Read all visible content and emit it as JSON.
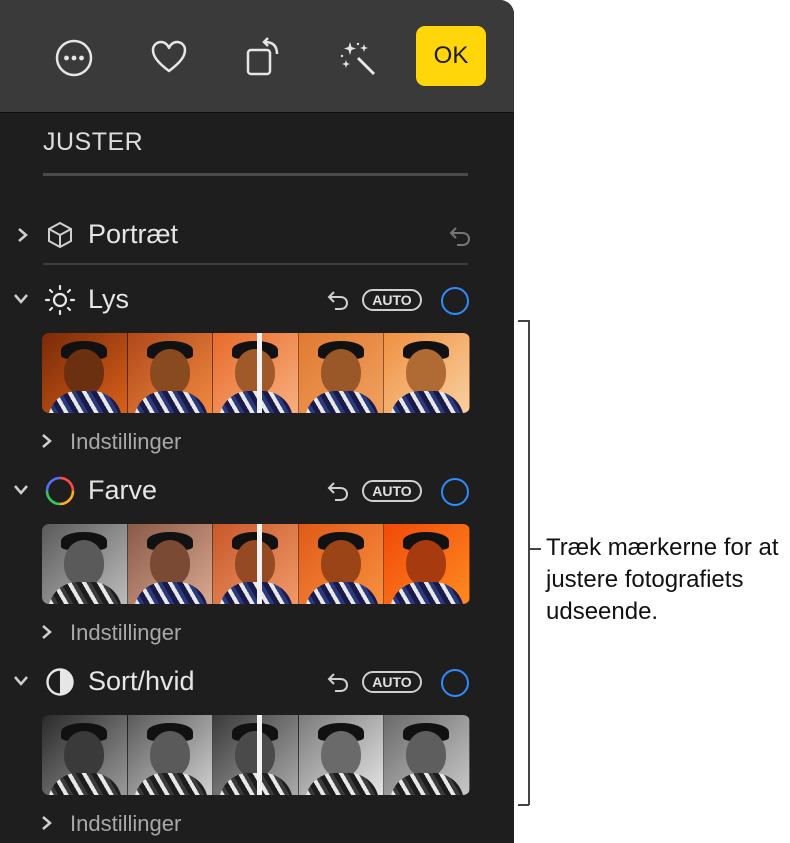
{
  "toolbar": {
    "buttons": [
      {
        "name": "more-options",
        "icon": "ellipsis-circle-icon"
      },
      {
        "name": "favorite",
        "icon": "heart-icon"
      },
      {
        "name": "rotate",
        "icon": "rotate-icon"
      },
      {
        "name": "enhance",
        "icon": "magic-wand-icon"
      }
    ],
    "ok_label": "OK"
  },
  "adjust": {
    "title": "JUSTER",
    "portrait": {
      "label": "Portræt",
      "icon": "cube-icon"
    },
    "sections": [
      {
        "label": "Lys",
        "icon": "sun-icon",
        "auto_label": "AUTO",
        "settings_label": "Indstillinger",
        "tone": "lys"
      },
      {
        "label": "Farve",
        "icon": "color-ring-icon",
        "auto_label": "AUTO",
        "settings_label": "Indstillinger",
        "tone": "farve"
      },
      {
        "label": "Sort/hvid",
        "icon": "half-circle-icon",
        "auto_label": "AUTO",
        "settings_label": "Indstillinger",
        "tone": "sorthvid"
      }
    ]
  },
  "callout": {
    "text": "Træk mærkerne for at justere fotografiets udseende."
  },
  "colors": {
    "accent_ok": "#ffd60a",
    "toggle_blue": "#2f8cff",
    "panel_bg": "#1e1e1e",
    "toolbar_bg": "#3a3a3a"
  }
}
